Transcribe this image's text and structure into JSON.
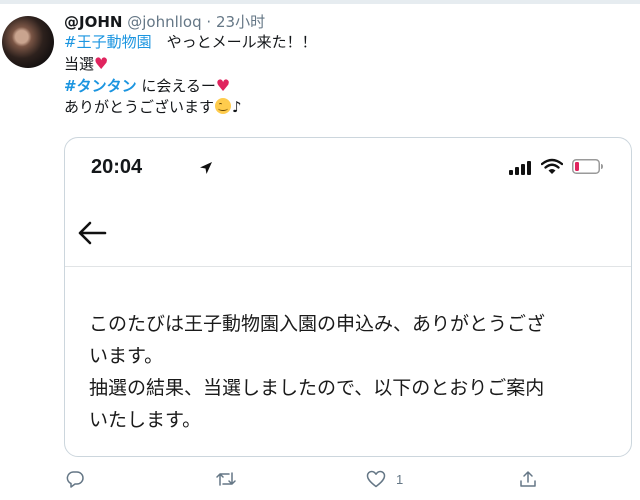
{
  "tweet": {
    "display_name": "@JOHN",
    "handle": "@johnlloq",
    "separator": "·",
    "time": "23小时",
    "line1_hashtag": "#王子動物園",
    "line1_text": "　やっとメール来た！！",
    "line2_text": "当選",
    "line3_hashtag": "#タンタン",
    "line3_text": " に会えるー",
    "line4_text": "ありがとうございます",
    "line4_suffix": "♪",
    "heart_glyph": "♥"
  },
  "card": {
    "phone_time": "20:04",
    "message_lines": [
      "このたびは王子動物園入園の申込み、ありがとうござ",
      "います。",
      "抽選の結果、当選しましたので、以下のとおりご案内",
      "いたします。"
    ]
  },
  "actions": {
    "reply_count": "",
    "retweet_count": "",
    "like_count": "1"
  },
  "colors": {
    "hashtag": "#1b95e0",
    "heart": "#e0245e",
    "muted": "#657786",
    "battery_low": "#e0245e"
  },
  "icons": [
    "reply-icon",
    "retweet-icon",
    "like-icon",
    "share-icon",
    "location-arrow-icon",
    "signal-icon",
    "wifi-icon",
    "battery-icon",
    "back-arrow-icon",
    "smile-emoji-icon"
  ]
}
